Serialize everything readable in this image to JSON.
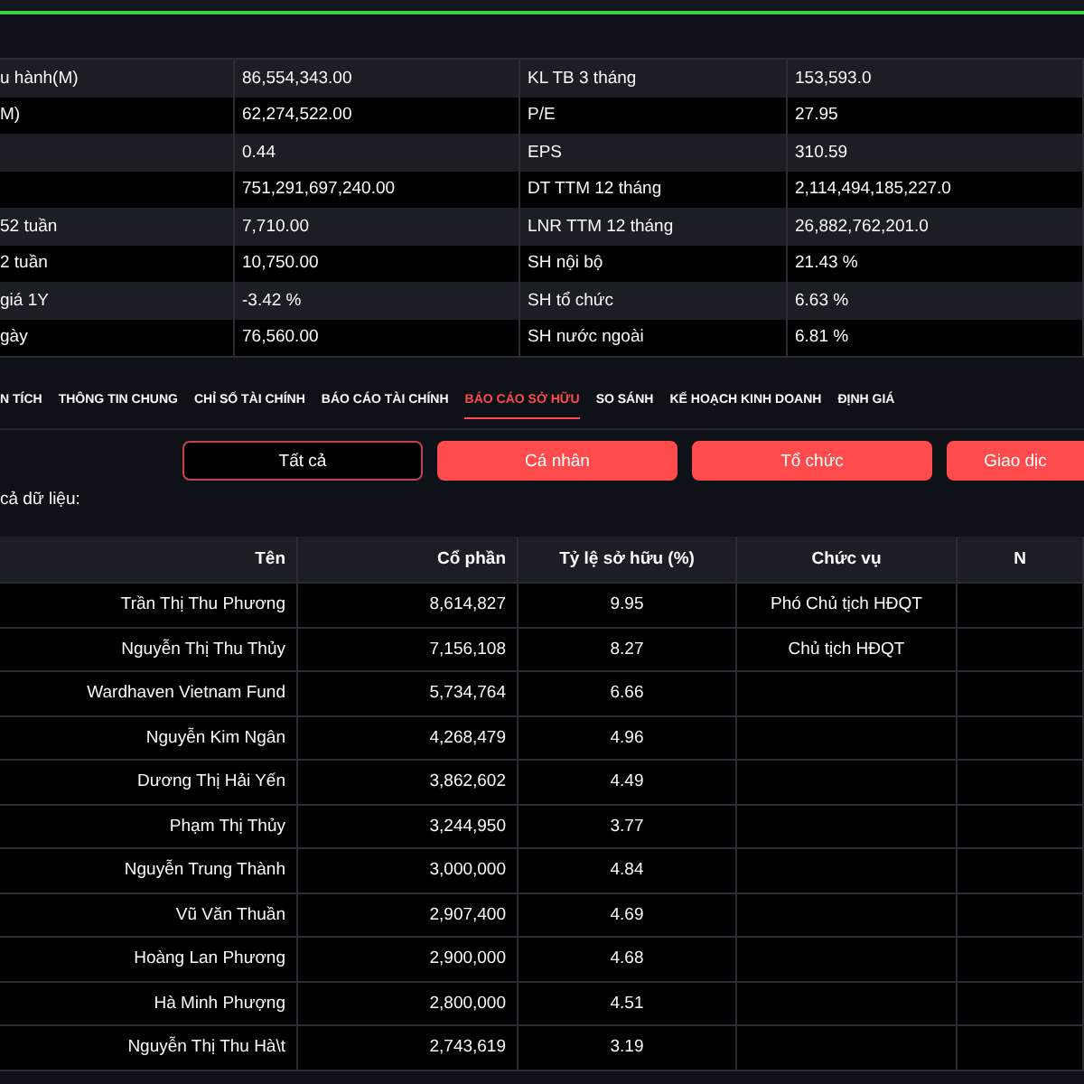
{
  "stats": [
    {
      "label": "u hành(M)",
      "value": "86,554,343.00",
      "label2": "KL TB 3 tháng",
      "value2": "153,593.0"
    },
    {
      "label": "M)",
      "value": "62,274,522.00",
      "label2": "P/E",
      "value2": "27.95"
    },
    {
      "value": "0.44",
      "label2": "EPS",
      "value2": "310.59"
    },
    {
      "value": "751,291,697,240.00",
      "label2": "DT TTM 12 tháng",
      "value2": "2,114,494,185,227.0"
    },
    {
      "label": "52 tuần",
      "value": "7,710.00",
      "label2": "LNR TTM 12 tháng",
      "value2": "26,882,762,201.0"
    },
    {
      "label": "2 tuần",
      "value": "10,750.00",
      "label2": "SH nội bộ",
      "value2": "21.43 %"
    },
    {
      "label": "giá 1Y",
      "value": "-3.42 %",
      "label2": "SH tổ chức",
      "value2": "6.63 %"
    },
    {
      "label": "gày",
      "value": "76,560.00",
      "label2": "SH nước ngoài",
      "value2": "6.81 %"
    }
  ],
  "tabs": [
    {
      "label": "N TÍCH",
      "selected": false
    },
    {
      "label": "THÔNG TIN CHUNG",
      "selected": false
    },
    {
      "label": "CHỈ SỐ TÀI CHÍNH",
      "selected": false
    },
    {
      "label": "BÁO CÁO TÀI CHÍNH",
      "selected": false
    },
    {
      "label": "BÁO CÁO SỞ HỮU",
      "selected": true
    },
    {
      "label": "SO SÁNH",
      "selected": false
    },
    {
      "label": "KẾ HOẠCH KINH DOANH",
      "selected": false
    },
    {
      "label": "ĐỊNH GIÁ",
      "selected": false
    }
  ],
  "filters": [
    {
      "label": "Tất cả",
      "selected": true
    },
    {
      "label": "Cá nhân",
      "selected": false
    },
    {
      "label": "Tổ chức",
      "selected": false
    },
    {
      "label": "Giao dịc",
      "selected": false
    }
  ],
  "data_label": "cả dữ liệu:",
  "table": {
    "columns": [
      "Tên",
      "Cổ phần",
      "Tỷ lệ sở hữu (%)",
      "Chức vụ",
      "N"
    ],
    "rows": [
      [
        "Trần Thị Thu Phương",
        "8,614,827",
        "9.95",
        "Phó Chủ tịch HĐQT"
      ],
      [
        "Nguyễn Thị Thu Thủy",
        "7,156,108",
        "8.27",
        "Chủ tịch HĐQT"
      ],
      [
        "Wardhaven Vietnam Fund",
        "5,734,764",
        "6.66",
        ""
      ],
      [
        "Nguyễn Kim Ngân",
        "4,268,479",
        "4.96",
        ""
      ],
      [
        "Dương Thị Hải Yến",
        "3,862,602",
        "4.49",
        ""
      ],
      [
        "Phạm Thị Thủy",
        "3,244,950",
        "3.77",
        ""
      ],
      [
        "Nguyễn Trung Thành",
        "3,000,000",
        "4.84",
        ""
      ],
      [
        "Vũ Văn Thuần",
        "2,907,400",
        "4.69",
        ""
      ],
      [
        "Hoàng Lan Phương",
        "2,900,000",
        "4.68",
        ""
      ],
      [
        "Hà Minh Phượng",
        "2,800,000",
        "4.51",
        ""
      ],
      [
        "Nguyễn Thị Thu Hà\\t",
        "2,743,619",
        "3.19",
        ""
      ]
    ]
  }
}
